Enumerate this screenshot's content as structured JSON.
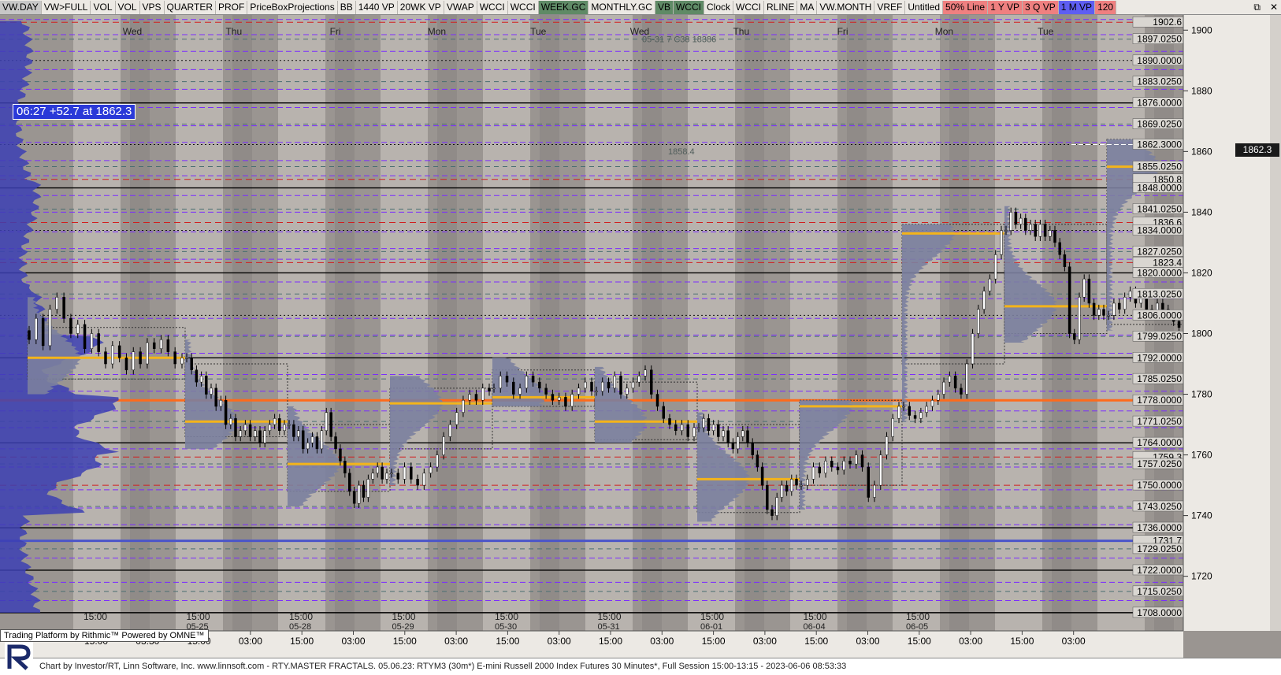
{
  "toolbar": {
    "items": [
      {
        "label": "VW.DAY",
        "bg": "#c7c7c7"
      },
      {
        "label": "VW>FULL",
        "bg": ""
      },
      {
        "label": "VOL",
        "bg": ""
      },
      {
        "label": "VOL",
        "bg": ""
      },
      {
        "label": "VPS",
        "bg": ""
      },
      {
        "label": "QUARTER",
        "bg": ""
      },
      {
        "label": "PROF",
        "bg": ""
      },
      {
        "label": "PriceBoxProjections",
        "bg": ""
      },
      {
        "label": "BB",
        "bg": ""
      },
      {
        "label": "1440 VP",
        "bg": ""
      },
      {
        "label": "20WK VP",
        "bg": ""
      },
      {
        "label": "VWAP",
        "bg": ""
      },
      {
        "label": "WCCI",
        "bg": ""
      },
      {
        "label": "WCCI",
        "bg": ""
      },
      {
        "label": "WEEK.GC",
        "bg": "#5f8a66"
      },
      {
        "label": "MONTHLY.GC",
        "bg": ""
      },
      {
        "label": "VB",
        "bg": "#5f8a66"
      },
      {
        "label": "WCCI",
        "bg": "#5f8a66"
      },
      {
        "label": "Clock",
        "bg": ""
      },
      {
        "label": "WCCI",
        "bg": ""
      },
      {
        "label": "RLINE",
        "bg": ""
      },
      {
        "label": "MA",
        "bg": ""
      },
      {
        "label": "VW.MONTH",
        "bg": ""
      },
      {
        "label": "VREF",
        "bg": ""
      },
      {
        "label": "Untitled",
        "bg": ""
      },
      {
        "label": "50% Line",
        "bg": "#ef8080"
      },
      {
        "label": "1 Y VP",
        "bg": "#ef8080"
      },
      {
        "label": "3 Q VP",
        "bg": "#ef8080"
      },
      {
        "label": "1 M VP",
        "bg": "#5e5ef2"
      },
      {
        "label": "120",
        "bg": "#ef8080"
      }
    ],
    "window_controls": [
      "⧉",
      "✕"
    ]
  },
  "timestamp": "06:27  +52.7 at 1862.3",
  "last_price": "1862.3",
  "rithmic_badge": "Trading Platform by Rithmic™  Powered by OMNE™",
  "footer": "Chart by Investor/RT, Linn Software, Inc. www.linnsoft.com - RTY.MASTER FRACTALS.  05.06.23: RTYM3 (30m*) E-mini Russell 2000 Index Futures 30 Minutes*, Full Session 15:00-13:15 - 2023-06-06 08:53:33",
  "colors": {
    "bg": "#9a9591",
    "session_band": "#bdb8b3",
    "candle": "#000000",
    "vp_fill": "#7b7f9e",
    "vp_dark": "#3b3eb0",
    "poc": "#f4b41a",
    "red_line": "#d21e1e",
    "purple_line": "#7b2cff",
    "orange_line": "#ff6a1a"
  },
  "chart_data": {
    "type": "candlestick",
    "ylim": [
      1702,
      1905
    ],
    "y_ticks": [
      1720,
      1740,
      1760,
      1780,
      1800,
      1820,
      1840,
      1860,
      1880,
      1900
    ],
    "day_labels": [
      "Wed",
      "Thu",
      "Fri",
      "Mon",
      "Tue",
      "Wed",
      "Thu",
      "Fri",
      "Mon",
      "Tue"
    ],
    "time_labels": [
      "15:00",
      "03:30",
      "15:00",
      "03:00",
      "15:00",
      "03:00",
      "15:00",
      "03:00",
      "15:00",
      "03:00",
      "15:00",
      "03:00",
      "15:00",
      "03:00",
      "15:00",
      "03:00",
      "15:00",
      "03:00",
      "15:00",
      "03:00"
    ],
    "session_date_labels": [
      "15:00",
      "15:00 05-25",
      "15:00 05-28",
      "15:00 05-29",
      "15:00 05-30",
      "15:00 05-31",
      "15:00 06-01",
      "15:00 06-04",
      "15:00 06-05"
    ],
    "price_levels": [
      {
        "price": 1902.6,
        "label": "1902.6",
        "style": "red"
      },
      {
        "price": 1897.025,
        "label": "1897.0250",
        "style": "dashgray"
      },
      {
        "price": 1890.0,
        "label": "1890.0000",
        "style": "dotted"
      },
      {
        "price": 1883.025,
        "label": "1883.0250",
        "style": "dashgray"
      },
      {
        "price": 1876.0,
        "label": "1876.0000",
        "style": "solid"
      },
      {
        "price": 1869.025,
        "label": "1869.0250",
        "style": "dashgray"
      },
      {
        "price": 1862.3,
        "label": "1862.3000",
        "style": "dotted"
      },
      {
        "price": 1855.025,
        "label": "1855.0250",
        "style": "dashgray"
      },
      {
        "price": 1850.8,
        "label": "1850.8",
        "style": "red"
      },
      {
        "price": 1848.0,
        "label": "1848.0000",
        "style": "solid"
      },
      {
        "price": 1841.025,
        "label": "1841.0250",
        "style": "dashgray"
      },
      {
        "price": 1836.6,
        "label": "1836.6",
        "style": "red"
      },
      {
        "price": 1834.0,
        "label": "1834.0000",
        "style": "dotted"
      },
      {
        "price": 1827.025,
        "label": "1827.0250",
        "style": "dashgray"
      },
      {
        "price": 1823.4,
        "label": "1823.4",
        "style": "red"
      },
      {
        "price": 1820.0,
        "label": "1820.0000",
        "style": "solid"
      },
      {
        "price": 1813.025,
        "label": "1813.0250",
        "style": "dashgray"
      },
      {
        "price": 1806.0,
        "label": "1806.0000",
        "style": "dotted"
      },
      {
        "price": 1799.025,
        "label": "1799.0250",
        "style": "dashgray"
      },
      {
        "price": 1792.0,
        "label": "1792.0000",
        "style": "solid"
      },
      {
        "price": 1785.025,
        "label": "1785.0250",
        "style": "dashgray"
      },
      {
        "price": 1778.0,
        "label": "1778.0000",
        "style": "orange"
      },
      {
        "price": 1771.025,
        "label": "1771.0250",
        "style": "dashgray"
      },
      {
        "price": 1764.0,
        "label": "1764.0000",
        "style": "solid"
      },
      {
        "price": 1759.3,
        "label": "1759.3",
        "style": "red"
      },
      {
        "price": 1757.025,
        "label": "1757.0250",
        "style": "dashgray"
      },
      {
        "price": 1750.0,
        "label": "1750.0000",
        "style": "red"
      },
      {
        "price": 1743.025,
        "label": "1743.0250",
        "style": "dashgray"
      },
      {
        "price": 1736.0,
        "label": "1736.0000",
        "style": "solid"
      },
      {
        "price": 1731.7,
        "label": "1731.7",
        "style": "blue"
      },
      {
        "price": 1729.025,
        "label": "1729.0250",
        "style": "dashgray"
      },
      {
        "price": 1722.0,
        "label": "1722.0000",
        "style": "solid"
      },
      {
        "price": 1715.025,
        "label": "1715.0250",
        "style": "dashgray"
      },
      {
        "price": 1708.0,
        "label": "1708.0000",
        "style": "solid"
      }
    ],
    "purple_levels": [
      1903.5,
      1898.5,
      1893.0,
      1887.0,
      1880.5,
      1874.5,
      1868.5,
      1863.0,
      1857.0,
      1852.0,
      1845.5,
      1840.0,
      1833.5,
      1828.0,
      1824.5,
      1817.0,
      1811.5,
      1805.0,
      1799.5,
      1793.5,
      1786.5,
      1781.0,
      1774.5,
      1769.0,
      1762.0,
      1756.0,
      1748.5,
      1742.5,
      1737.0,
      1726.0,
      1718.0,
      1712.0
    ],
    "chart_annotations": [
      "1858.4",
      "05-31 7 C38 18386"
    ],
    "sessions": [
      {
        "open": 1801,
        "close": 1792,
        "high": 1812,
        "low": 1780,
        "poc": 1792,
        "va": [
          1785,
          1802
        ],
        "path": [
          1798,
          1805,
          1796,
          1808,
          1812,
          1805,
          1800,
          1803,
          1795,
          1800,
          1794,
          1790,
          1796,
          1792,
          1788,
          1794,
          1790,
          1797,
          1795,
          1798,
          1794,
          1790,
          1792
        ]
      },
      {
        "open": 1792,
        "close": 1770,
        "high": 1798,
        "low": 1762,
        "poc": 1771,
        "va": [
          1766,
          1790
        ],
        "path": [
          1792,
          1788,
          1784,
          1786,
          1780,
          1782,
          1776,
          1778,
          1770,
          1772,
          1766,
          1768,
          1770,
          1766,
          1768,
          1764,
          1768,
          1770,
          1772,
          1768,
          1770
        ]
      },
      {
        "open": 1770,
        "close": 1754,
        "high": 1776,
        "low": 1743,
        "poc": 1757,
        "va": [
          1748,
          1770
        ],
        "path": [
          1770,
          1766,
          1768,
          1762,
          1764,
          1766,
          1762,
          1768,
          1774,
          1766,
          1762,
          1758,
          1754,
          1748,
          1744,
          1750,
          1746,
          1752,
          1754,
          1756,
          1752,
          1754
        ]
      },
      {
        "open": 1754,
        "close": 1781,
        "high": 1786,
        "low": 1750,
        "poc": 1777,
        "va": [
          1762,
          1782
        ],
        "path": [
          1754,
          1752,
          1756,
          1752,
          1750,
          1754,
          1756,
          1760,
          1766,
          1770,
          1774,
          1778,
          1780,
          1778,
          1782,
          1781
        ]
      },
      {
        "open": 1782,
        "close": 1781,
        "high": 1792,
        "low": 1776,
        "poc": 1779,
        "va": [
          1776,
          1788
        ],
        "path": [
          1782,
          1786,
          1784,
          1780,
          1782,
          1786,
          1784,
          1782,
          1780,
          1778,
          1779,
          1776,
          1780,
          1782,
          1784,
          1781
        ]
      },
      {
        "open": 1781,
        "close": 1769,
        "high": 1789,
        "low": 1764,
        "poc": 1771,
        "va": [
          1765,
          1784
        ],
        "path": [
          1781,
          1784,
          1782,
          1786,
          1780,
          1782,
          1784,
          1786,
          1788,
          1780,
          1776,
          1772,
          1770,
          1768,
          1770,
          1766,
          1769
        ]
      },
      {
        "open": 1769,
        "close": 1750,
        "high": 1774,
        "low": 1738,
        "poc": 1752,
        "va": [
          1741,
          1770
        ],
        "path": [
          1769,
          1772,
          1768,
          1770,
          1766,
          1768,
          1764,
          1762,
          1766,
          1768,
          1764,
          1760,
          1756,
          1750,
          1742,
          1740,
          1746,
          1750,
          1748,
          1752,
          1750
        ]
      },
      {
        "open": 1750,
        "close": 1776,
        "high": 1778,
        "low": 1742,
        "poc": 1776,
        "va": [
          1750,
          1778
        ],
        "path": [
          1750,
          1752,
          1756,
          1754,
          1758,
          1756,
          1755,
          1758,
          1757,
          1760,
          1756,
          1746,
          1750,
          1760,
          1766,
          1772,
          1776
        ]
      },
      {
        "open": 1776,
        "close": 1834,
        "high": 1836,
        "low": 1771,
        "poc": 1833,
        "va": [
          1790,
          1836
        ],
        "path": [
          1776,
          1773,
          1772,
          1774,
          1776,
          1778,
          1780,
          1784,
          1786,
          1782,
          1780,
          1790,
          1800,
          1808,
          1814,
          1818,
          1826,
          1834
        ]
      },
      {
        "open": 1834,
        "close": 1806,
        "high": 1842,
        "low": 1797,
        "poc": 1809,
        "va": [
          1800,
          1836
        ],
        "path": [
          1834,
          1840,
          1836,
          1838,
          1834,
          1836,
          1832,
          1836,
          1832,
          1834,
          1830,
          1826,
          1822,
          1800,
          1798,
          1812,
          1818,
          1810,
          1806,
          1808,
          1806
        ]
      },
      {
        "open": 1806,
        "close": 1862,
        "high": 1864,
        "low": 1801,
        "poc": 1855,
        "va": [
          1803,
          1864
        ],
        "path": [
          1806,
          1810,
          1808,
          1812,
          1814,
          1810,
          1812,
          1808,
          1806,
          1810,
          1808,
          1806,
          1804,
          1802,
          1820,
          1840,
          1850,
          1858,
          1862
        ]
      }
    ]
  }
}
